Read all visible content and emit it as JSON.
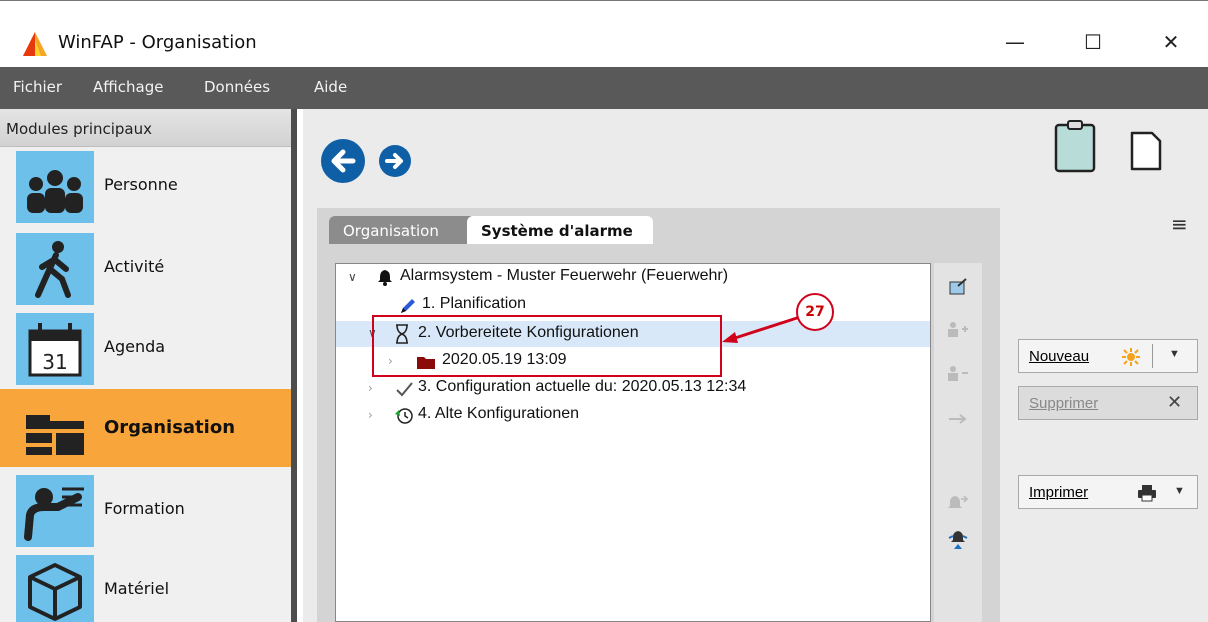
{
  "window": {
    "title": "WinFAP - Organisation",
    "minimize_glyph": "—",
    "maximize_glyph": "☐",
    "close_glyph": "✕"
  },
  "menu": [
    "Fichier",
    "Affichage",
    "Données",
    "Aide"
  ],
  "sidebar": {
    "header": "Modules principaux",
    "items": [
      {
        "label": "Personne",
        "icon": "people-icon"
      },
      {
        "label": "Activité",
        "icon": "walking-person-icon"
      },
      {
        "label": "Agenda",
        "icon": "calendar-icon",
        "badge": "31"
      },
      {
        "label": "Organisation",
        "icon": "folders-icon",
        "active": true
      },
      {
        "label": "Formation",
        "icon": "teacher-icon"
      },
      {
        "label": "Matériel",
        "icon": "box-icon"
      }
    ]
  },
  "tabs": [
    {
      "label": "Organisation",
      "active": false
    },
    {
      "label": "Système d'alarme",
      "active": true
    }
  ],
  "tree": [
    {
      "text": "Alarmsystem - Muster Feuerwehr (Feuerwehr)",
      "icon": "bell-icon",
      "expanded": true
    },
    {
      "text": "1. Planification",
      "icon": "pencil-icon"
    },
    {
      "text": "2. Vorbereitete Konfigurationen",
      "icon": "hourglass-icon",
      "expanded": true,
      "selected": true
    },
    {
      "text": "2020.05.19 13:09",
      "icon": "folder-icon"
    },
    {
      "text": "3. Configuration actuelle du: 2020.05.13 12:34",
      "icon": "checkmark-icon"
    },
    {
      "text": "4. Alte Konfigurationen",
      "icon": "history-icon"
    }
  ],
  "annotation": {
    "number": "27"
  },
  "right_panel": {
    "menu_glyph": "≡",
    "new_label": "Nouveau",
    "delete_label": "Supprimer",
    "print_label": "Imprimer"
  },
  "colors": {
    "accent_orange": "#f8a63b",
    "nav_blue": "#0f5fa6",
    "menubar": "#595959",
    "annotation_red": "#d0021b",
    "module_icon_bg": "#6cc0ea"
  }
}
